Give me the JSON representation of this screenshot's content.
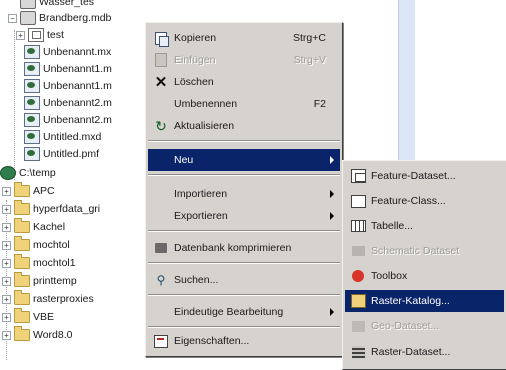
{
  "tree": {
    "items": [
      {
        "label": "Wasser_tes",
        "indent": 1,
        "icon": "gdb",
        "expander": ""
      },
      {
        "label": "Brandberg.mdb",
        "indent": 1,
        "icon": "gdb",
        "expander": "−"
      },
      {
        "label": "test",
        "indent": 2,
        "icon": "fd",
        "expander": "+"
      },
      {
        "label": "Unbenannt.mx",
        "indent": 2,
        "icon": "mxd",
        "expander": ""
      },
      {
        "label": "Unbenannt1.m",
        "indent": 2,
        "icon": "mxd",
        "expander": ""
      },
      {
        "label": "Unbenannt1.m",
        "indent": 2,
        "icon": "mxd",
        "expander": ""
      },
      {
        "label": "Unbenannt2.m",
        "indent": 2,
        "icon": "mxd",
        "expander": ""
      },
      {
        "label": "Unbenannt2.m",
        "indent": 2,
        "icon": "mxd",
        "expander": ""
      },
      {
        "label": "Untitled.mxd",
        "indent": 2,
        "icon": "mxd",
        "expander": ""
      },
      {
        "label": "Untitled.pmf",
        "indent": 2,
        "icon": "mxd",
        "expander": ""
      },
      {
        "label": "C:\\temp",
        "indent": 0,
        "icon": "globe",
        "expander": "−"
      },
      {
        "label": "APC",
        "indent": 1,
        "icon": "folder",
        "expander": "+"
      },
      {
        "label": "hyperfdata_gri",
        "indent": 1,
        "icon": "folder",
        "expander": "+"
      },
      {
        "label": "Kachel",
        "indent": 1,
        "icon": "folder",
        "expander": "+"
      },
      {
        "label": "mochtol",
        "indent": 1,
        "icon": "folder",
        "expander": "+"
      },
      {
        "label": "mochtol1",
        "indent": 1,
        "icon": "folder",
        "expander": "+"
      },
      {
        "label": "printtemp",
        "indent": 1,
        "icon": "folder",
        "expander": "+"
      },
      {
        "label": "rasterproxies",
        "indent": 1,
        "icon": "folder",
        "expander": "+"
      },
      {
        "label": "VBE",
        "indent": 1,
        "icon": "folder",
        "expander": "+"
      },
      {
        "label": "Word8.0",
        "indent": 1,
        "icon": "folder",
        "expander": "+"
      }
    ]
  },
  "context_menu": {
    "items": [
      {
        "label": "Kopieren",
        "shortcut": "Strg+C",
        "icon": "copy-icon",
        "state": "normal"
      },
      {
        "label": "Einfügen",
        "shortcut": "Strg+V",
        "icon": "paste-icon",
        "state": "disabled"
      },
      {
        "label": "Löschen",
        "shortcut": "",
        "icon": "delete-icon",
        "state": "normal"
      },
      {
        "label": "Umbenennen",
        "shortcut": "F2",
        "icon": "",
        "state": "normal"
      },
      {
        "label": "Aktualisieren",
        "shortcut": "",
        "icon": "refresh-icon",
        "state": "normal"
      },
      {
        "label": "Neu",
        "shortcut": "",
        "icon": "",
        "state": "highlighted",
        "submenu": true
      },
      {
        "label": "Importieren",
        "shortcut": "",
        "icon": "",
        "state": "normal",
        "submenu": true
      },
      {
        "label": "Exportieren",
        "shortcut": "",
        "icon": "",
        "state": "normal",
        "submenu": true
      },
      {
        "label": "Datenbank komprimieren",
        "shortcut": "",
        "icon": "compress-icon",
        "state": "normal"
      },
      {
        "label": "Suchen...",
        "shortcut": "",
        "icon": "search-icon",
        "state": "normal"
      },
      {
        "label": "Eindeutige Bearbeitung",
        "shortcut": "",
        "icon": "",
        "state": "normal",
        "submenu": true
      },
      {
        "label": "Eigenschaften...",
        "shortcut": "",
        "icon": "properties-icon",
        "state": "normal"
      }
    ]
  },
  "submenu": {
    "items": [
      {
        "label": "Feature-Dataset...",
        "icon": "feature-dataset-icon",
        "state": "normal"
      },
      {
        "label": "Feature-Class...",
        "icon": "feature-class-icon",
        "state": "normal"
      },
      {
        "label": "Tabelle...",
        "icon": "table-icon",
        "state": "normal"
      },
      {
        "label": "Schematic Dataset",
        "icon": "schematic-icon",
        "state": "disabled"
      },
      {
        "label": "Toolbox",
        "icon": "toolbox-icon",
        "state": "normal"
      },
      {
        "label": "Raster-Katalog...",
        "icon": "raster-catalog-icon",
        "state": "highlighted"
      },
      {
        "label": "Geo-Dataset...",
        "icon": "geodataset-icon",
        "state": "disabled"
      },
      {
        "label": "Raster-Dataset...",
        "icon": "raster-dataset-icon",
        "state": "normal"
      }
    ]
  },
  "colors": {
    "menu_bg": "#d6d3ce",
    "highlight": "#0a246a",
    "disabled_text": "#9c9a94"
  }
}
